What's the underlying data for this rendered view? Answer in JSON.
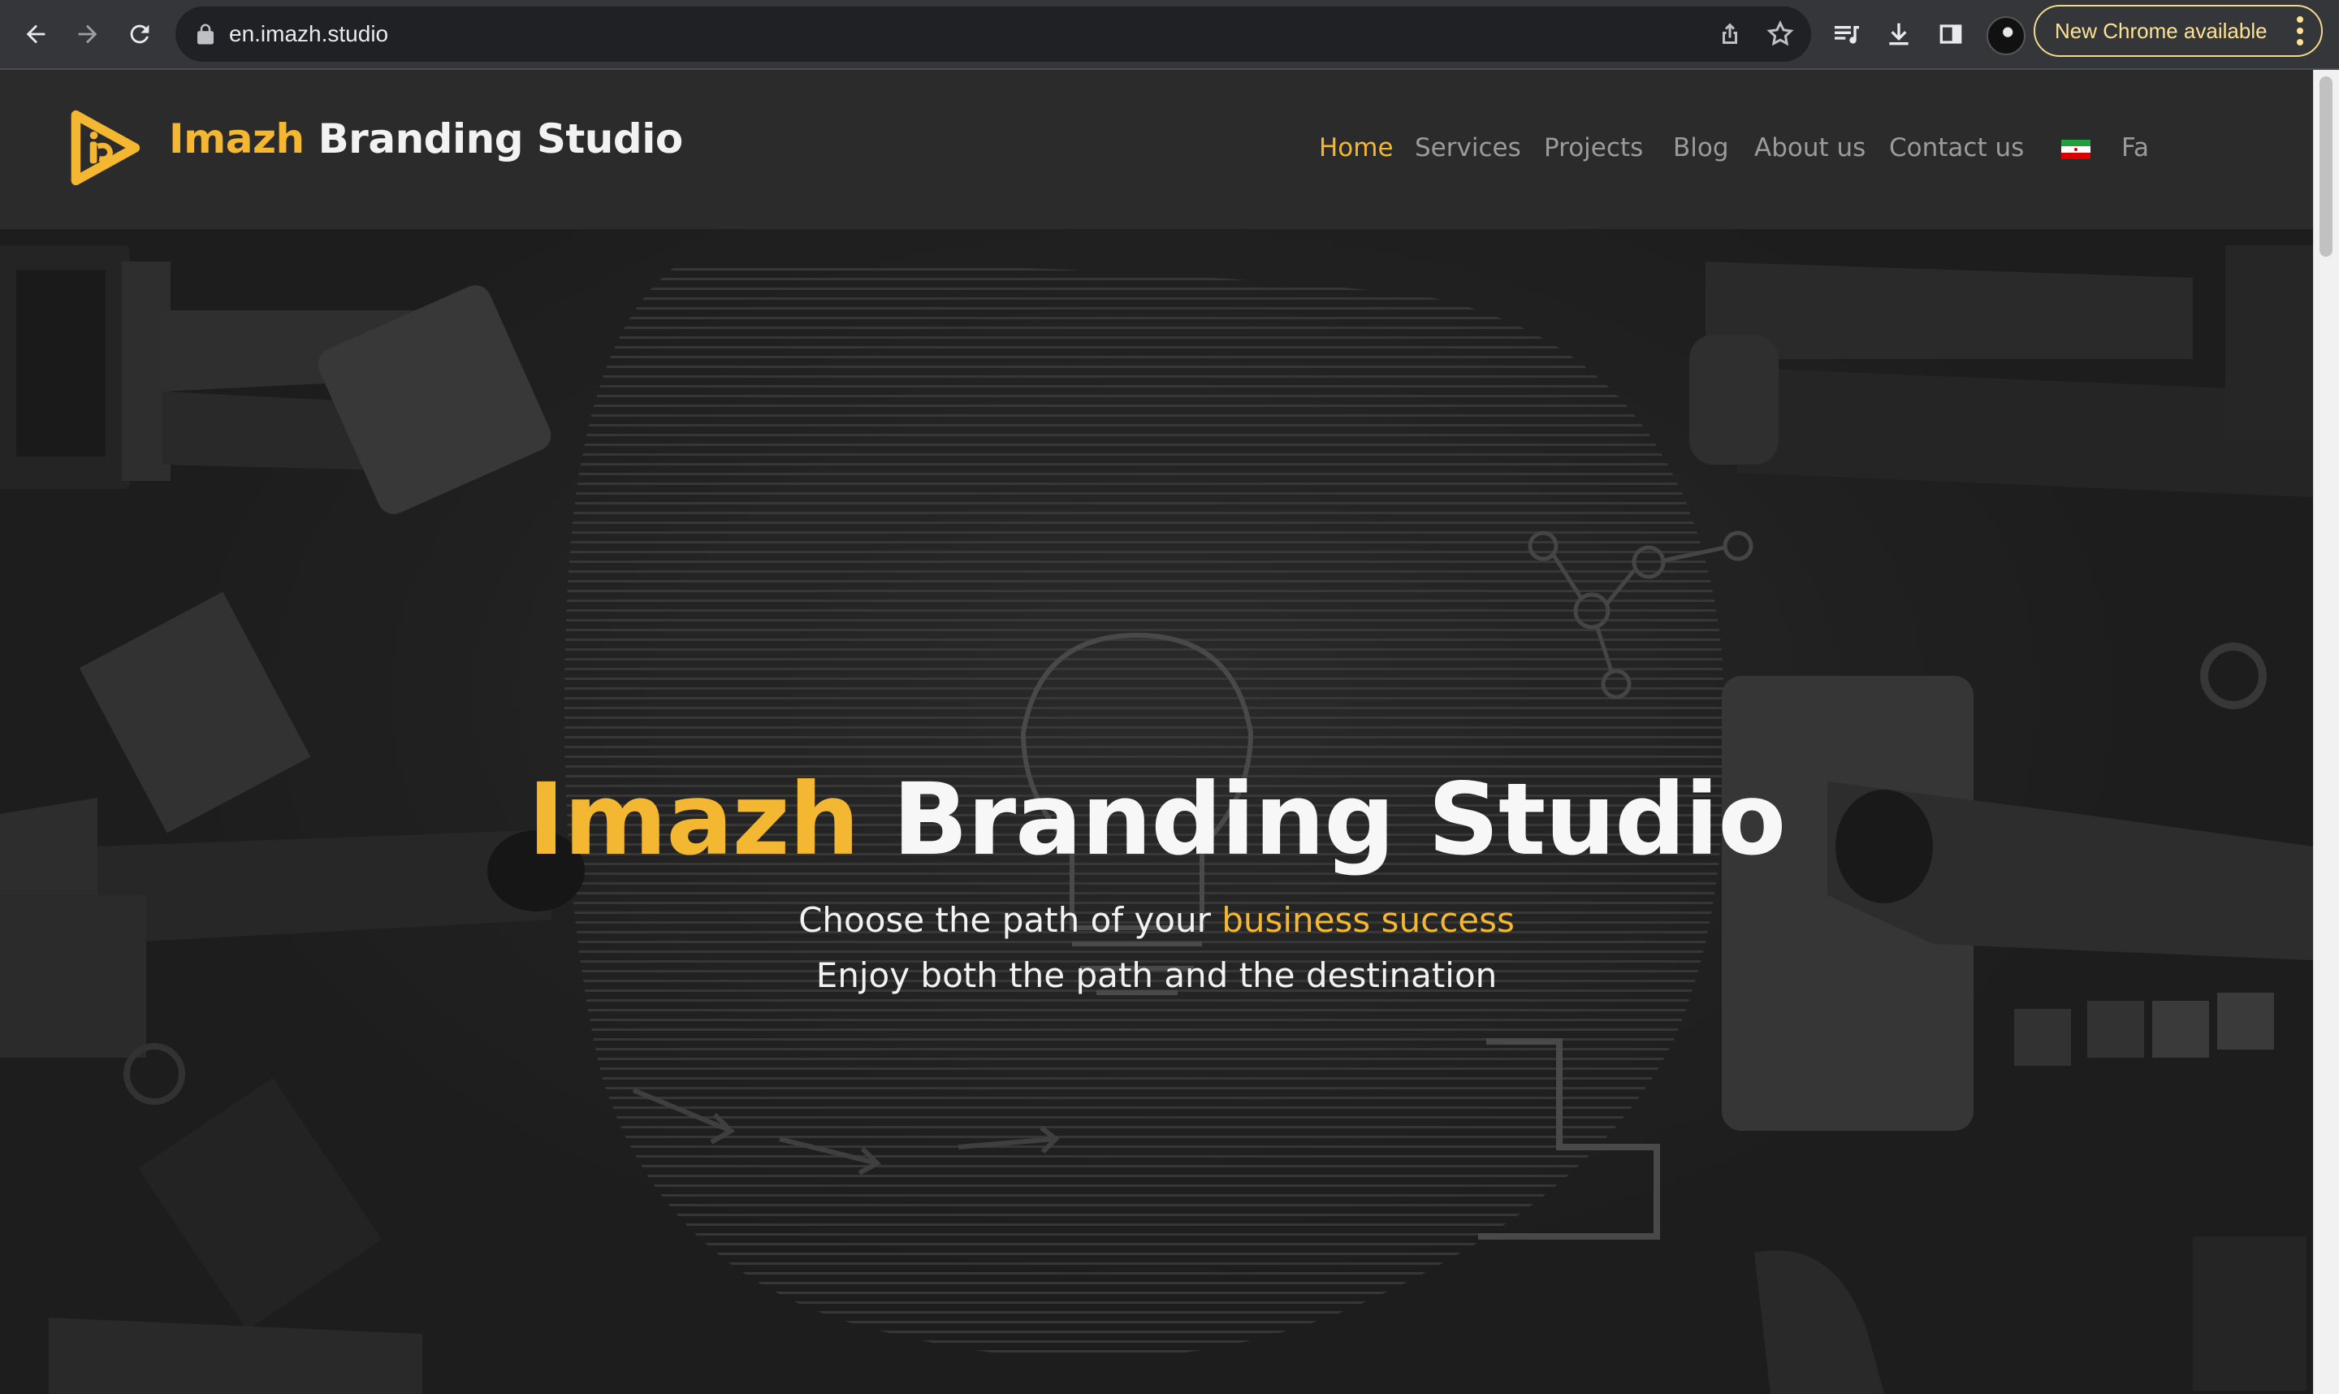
{
  "browser": {
    "url": "en.imazh.studio",
    "update_label": "New Chrome available",
    "icons": {
      "back": "back-arrow-icon",
      "forward": "forward-arrow-icon",
      "reload": "reload-icon",
      "lock": "lock-icon",
      "share": "share-icon",
      "bookmark": "star-icon",
      "reading_list": "reading-list-icon",
      "download": "download-icon",
      "side_panel": "side-panel-icon",
      "menu": "kebab-menu-icon"
    }
  },
  "site": {
    "brand_accent": "Imazh",
    "brand_rest": "Branding Studio",
    "nav": [
      {
        "label": "Home",
        "active": true
      },
      {
        "label": "Services",
        "active": false
      },
      {
        "label": "Projects",
        "active": false
      },
      {
        "label": "Blog",
        "active": false
      },
      {
        "label": "About us",
        "active": false
      },
      {
        "label": "Contact us",
        "active": false
      }
    ],
    "language": "Fa"
  },
  "hero": {
    "title_accent": "Imazh",
    "title_rest": "Branding Studio",
    "line1_prefix": "Choose the path of your",
    "line1_accent": "business success",
    "line2": "Enjoy both the path and the destination"
  },
  "colors": {
    "accent": "#f4b731",
    "header_bg": "#2b2b2b",
    "hero_bg": "#242424",
    "chrome_bg": "#35363a"
  }
}
